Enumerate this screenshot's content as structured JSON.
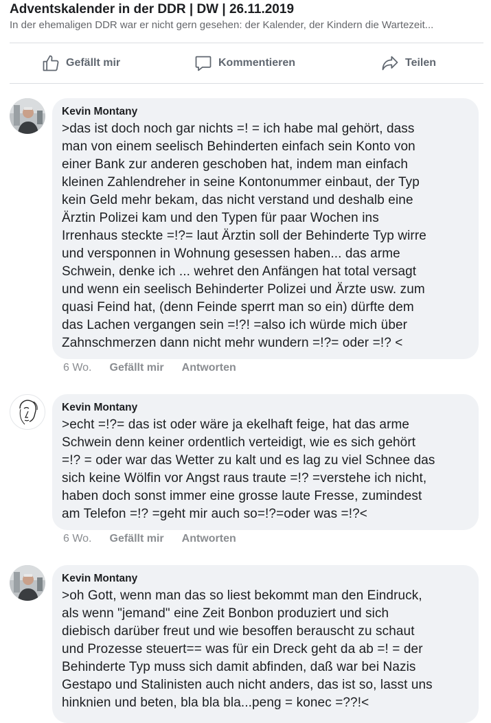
{
  "post": {
    "title": "Adventskalender in der DDR | DW | 26.11.2019",
    "subtitle": "In der ehemaligen DDR war er nicht gern gesehen: der Kalender, der Kindern die Wartezeit..."
  },
  "actions": {
    "like_label": "Gefällt mir",
    "comment_label": "Kommentieren",
    "share_label": "Teilen"
  },
  "comments": [
    {
      "author": "Kevin Montany",
      "text": ">das ist doch noch gar nichts =! = ich habe mal gehört, dass\nman von einem seelisch Behinderten einfach sein Konto von\neiner Bank zur anderen geschoben hat, indem man einfach\nkleinen Zahlendreher in seine Kontonummer einbaut, der Typ\nkein Geld mehr bekam, das nicht verstand und deshalb eine\nÄrztin Polizei kam und den Typen für paar Wochen ins\nIrrenhaus steckte =!?= laut Ärztin soll der Behinderte Typ wirre\nund versponnen in Wohnung gesessen haben... das arme\nSchwein, denke ich ... wehret den Anfängen hat total versagt\nund wenn ein seelisch Behinderter Polizei und Ärzte usw. zum\nquasi  Feind hat, (denn Feinde sperrt man so ein) dürfte dem\ndas Lachen vergangen sein =!?! =also ich würde mich über\nZahnschmerzen dann nicht mehr wundern =!?= oder =!? <",
      "time": "6 Wo.",
      "like_label": "Gefällt mir",
      "reply_label": "Antworten",
      "avatar_icon": "user-photo-avatar"
    },
    {
      "author": "Kevin Montany",
      "text": ">echt =!?= das ist oder wäre ja ekelhaft feige, hat das arme\nSchwein denn keiner ordentlich verteidigt, wie es sich gehört\n=!? = oder war das Wetter zu kalt und es lag zu viel Schnee das\nsich keine Wölfin vor Angst raus traute =!? =verstehe ich nicht,\nhaben doch sonst immer eine grosse laute Fresse, zumindest\nam Telefon =!? =geht mir auch so=!?=oder was =!?<",
      "time": "6 Wo.",
      "like_label": "Gefällt mir",
      "reply_label": "Antworten",
      "avatar_icon": "sketch-face-avatar"
    },
    {
      "author": "Kevin Montany",
      "text": ">oh Gott, wenn man das so liest bekommt man den Eindruck,\nals wenn \"jemand\" eine Zeit Bonbon produziert und sich\ndiebisch darüber freut und wie besoffen berauscht zu schaut\nund Prozesse  steuert== was für ein Dreck geht da ab =! = der\nBehinderte Typ muss sich damit abfinden, daß war bei Nazis\nGestapo  und Stalinisten auch nicht anders, das ist so, lasst uns\nhinknien und beten, bla bla bla...peng = konec =??!<",
      "avatar_icon": "user-photo-avatar"
    }
  ],
  "colors": {
    "bubble": "#f0f2f5",
    "meta_text": "#8a8d91",
    "action_text": "#606770"
  }
}
